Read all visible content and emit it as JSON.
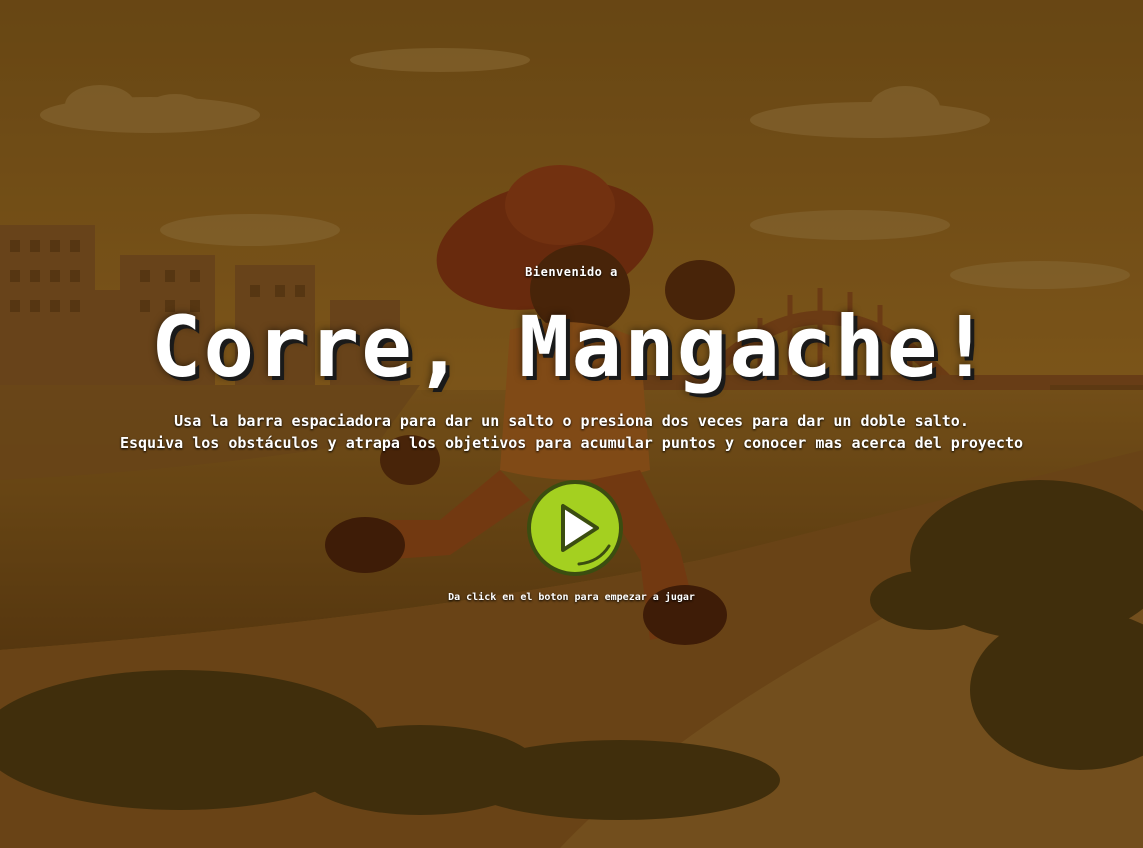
{
  "welcome_text": "Bienvenido a",
  "game_title": "Corre, Mangache!",
  "instructions": [
    "Usa la barra espaciadora para dar un salto o presiona dos veces para dar un doble salto.",
    "Esquiva los obstáculos y atrapa los objetivos para acumular puntos y conocer mas acerca del proyecto"
  ],
  "play_button_icon": "play-icon",
  "play_hint": "Da click en el boton para empezar a jugar",
  "colors": {
    "play_button": "#a4d020",
    "play_border": "#3b4d10",
    "text": "#ffffff"
  }
}
